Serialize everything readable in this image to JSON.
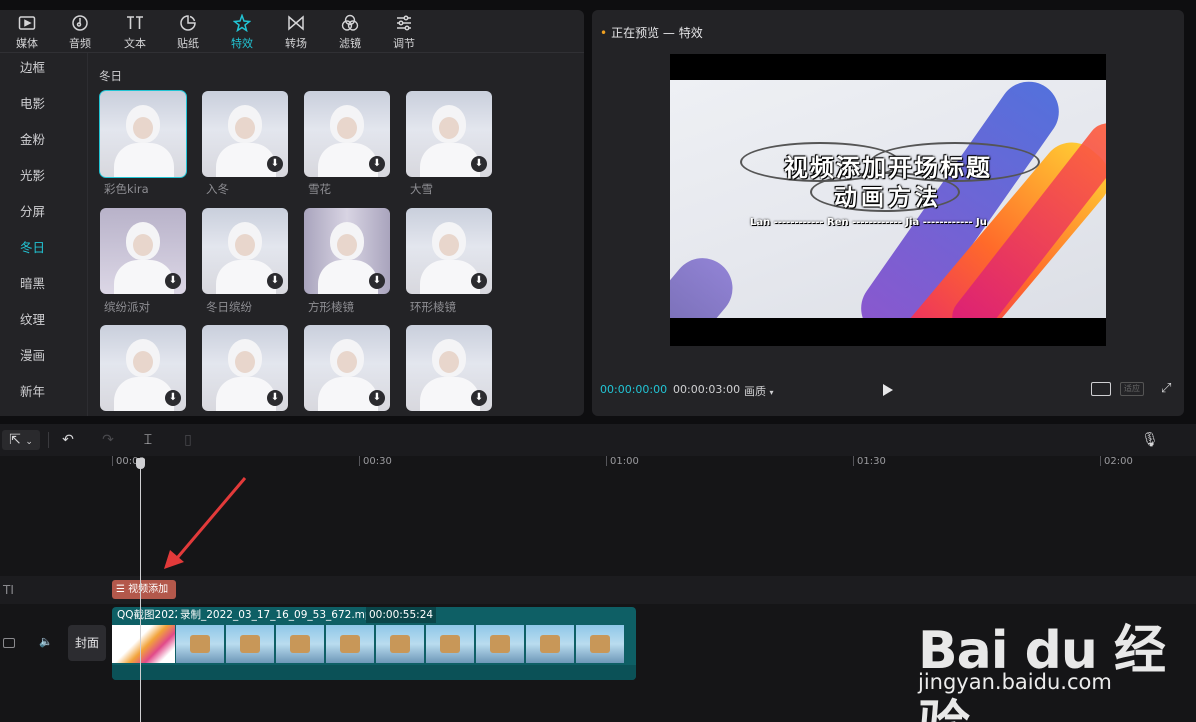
{
  "tabs": [
    {
      "label": "媒体",
      "icon": "play-square-icon"
    },
    {
      "label": "音频",
      "icon": "music-icon"
    },
    {
      "label": "文本",
      "icon": "text-icon"
    },
    {
      "label": "贴纸",
      "icon": "sticker-icon"
    },
    {
      "label": "特效",
      "icon": "sparkle-icon",
      "active": true
    },
    {
      "label": "转场",
      "icon": "transition-icon"
    },
    {
      "label": "滤镜",
      "icon": "filter-icon"
    },
    {
      "label": "调节",
      "icon": "sliders-icon"
    }
  ],
  "categories": [
    "边框",
    "电影",
    "金粉",
    "光影",
    "分屏",
    "冬日",
    "暗黑",
    "纹理",
    "漫画",
    "新年"
  ],
  "active_category": "冬日",
  "effects": {
    "section_title": "冬日",
    "items": [
      {
        "label": "彩色kira",
        "selected": true,
        "download": false
      },
      {
        "label": "入冬",
        "download": true
      },
      {
        "label": "雪花",
        "download": true
      },
      {
        "label": "大雪",
        "download": true
      },
      {
        "label": "缤纷派对",
        "download": true
      },
      {
        "label": "冬日缤纷",
        "download": true
      },
      {
        "label": "方形棱镜",
        "download": true
      },
      {
        "label": "环形棱镜",
        "download": true
      },
      {
        "label": "",
        "download": true
      },
      {
        "label": "",
        "download": true
      },
      {
        "label": "",
        "download": true
      },
      {
        "label": "",
        "download": true
      }
    ]
  },
  "preview": {
    "title": "正在预览 — 特效",
    "video_title_line1": "视频添加开场标题",
    "video_title_line2": "动画方法",
    "credits": "Lan ------------ Ren ------------ Jia ------------ Ju",
    "current_time": "00:00:00:00",
    "duration": "00:00:03:00",
    "quality": "画质",
    "fit_label": "适应"
  },
  "timeline": {
    "ruler_labels": [
      "00:00",
      "00:30",
      "01:00",
      "01:30",
      "02:00"
    ],
    "text_clip_label": "视频添加",
    "cover_label": "封面",
    "video_clip_first": "QQ截图2022",
    "video_clip_name": "录制_2022_03_17_16_09_53_672.mp4",
    "video_clip_duration": "00:00:55:24"
  },
  "watermark": {
    "logo": "Bai du 经验",
    "url": "jingyan.baidu.com"
  },
  "colors": {
    "accent": "#22c4d4",
    "text_clip": "#b3584b",
    "video_clip": "#0e5f65"
  }
}
